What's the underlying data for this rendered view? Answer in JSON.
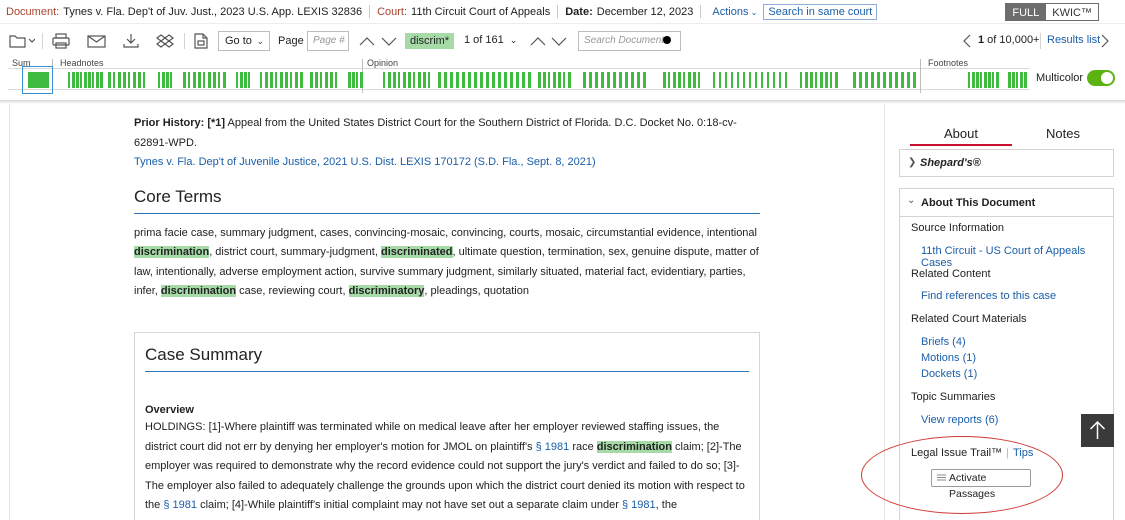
{
  "docbar": {
    "doc_label": "Document:",
    "doc_value": "Tynes v. Fla. Dep't of Juv. Just., 2023 U.S. App. LEXIS 32836",
    "court_label": "Court:",
    "court_value": "11th Circuit Court of Appeals",
    "date_label": "Date:",
    "date_value": "December 12, 2023",
    "actions": "Actions",
    "same_court": "Search in same court",
    "full": "FULL",
    "kwic": "KWIC™"
  },
  "toolbar": {
    "goto": "Go to",
    "page_label": "Page",
    "page_placeholder": "Page #",
    "term": "discrim*",
    "term_count": "1 of 161",
    "search_placeholder": "Search Document",
    "result_bold": "1",
    "result_rest": " of 10,000+",
    "results_list": "Results list"
  },
  "navmap": {
    "sections": [
      "Sum",
      "Headnotes",
      "Opinion",
      "Footnotes"
    ],
    "multicolor": "Multicolor",
    "multicolor_on": true,
    "highlight_color": "#3fbb3f"
  },
  "document": {
    "prior_history_label": "Prior History:",
    "prior_history_page": "[*1]",
    "prior_history_text": " Appeal from the United States District Court for the Southern District of Florida. D.C. Docket No. 0:18-cv-62891-WPD.",
    "prior_history_link": "Tynes v. Fla. Dep't of Juvenile Justice, 2021 U.S. Dist. LEXIS 170172 (S.D. Fla., Sept. 8, 2021)",
    "core_terms_heading": "Core Terms",
    "core_terms": [
      {
        "t": "prima facie case, summary judgment, cases, convincing-mosaic, convincing, courts, mosaic, circumstantial evidence, intentional "
      },
      {
        "t": "discrimination",
        "hl": true
      },
      {
        "t": ", district court, summary-judgment, "
      },
      {
        "t": "discriminated",
        "hl": true
      },
      {
        "t": ", ultimate question, termination, sex, genuine dispute, matter of law, intentionally, adverse employment action, survive summary judgment, similarly situated, material fact, evidentiary, parties, infer, "
      },
      {
        "t": "discrimination",
        "hl": true
      },
      {
        "t": " case, reviewing court, "
      },
      {
        "t": "discriminatory",
        "hl": true
      },
      {
        "t": ", pleadings, quotation"
      }
    ],
    "case_summary_heading": "Case Summary",
    "overview_label": "Overview",
    "overview": [
      {
        "t": "HOLDINGS: [1]-Where plaintiff was terminated while on medical leave after her employer reviewed staffing issues, the district court did not err by denying her employer's motion for JMOL on plaintiff's "
      },
      {
        "t": "§ 1981",
        "link": true
      },
      {
        "t": " race "
      },
      {
        "t": "discrimination",
        "hl": true
      },
      {
        "t": " claim; [2]-The employer was required to demonstrate why the record evidence could not support the jury's verdict and failed to do so; [3]-The employer also failed to adequately challenge the grounds upon which the district court denied its motion with respect to the "
      },
      {
        "t": "§ 1981",
        "link": true
      },
      {
        "t": " claim; [4]-While plaintiff's initial complaint may not have set out a separate claim under "
      },
      {
        "t": "§ 1981",
        "link": true
      },
      {
        "t": ", the"
      }
    ]
  },
  "panel": {
    "tab_about": "About",
    "tab_notes": "Notes",
    "shepards": "Shepard's®",
    "about_title": "About This Document",
    "source_info": "Source Information",
    "source_link": "11th Circuit - US Court of Appeals Cases",
    "related_content": "Related Content",
    "related_link": "Find references to this case",
    "related_court": "Related Court Materials",
    "briefs": "Briefs (4)",
    "motions": "Motions (1)",
    "dockets": "Dockets (1)",
    "topic_summaries": "Topic Summaries",
    "view_reports": "View reports (6)",
    "legal_issue": "Legal Issue Trail™",
    "tips": "Tips",
    "activate": "Activate Passages",
    "annotation_color": "#d03c38"
  }
}
